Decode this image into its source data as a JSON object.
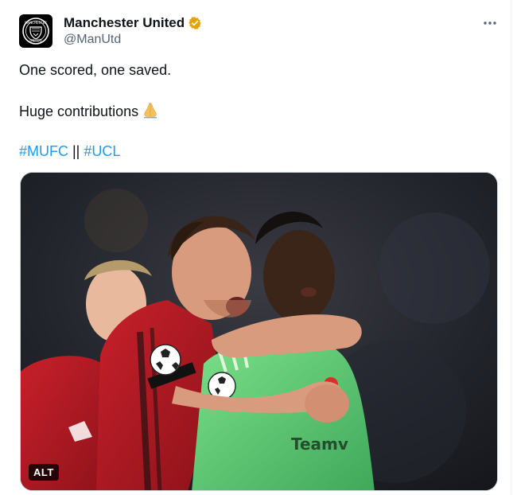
{
  "author": {
    "display_name": "Manchester United",
    "handle": "@ManUtd",
    "verified": true,
    "verified_color": "#e2a400",
    "avatar_icon": "manchester-united-crest-icon"
  },
  "more_icon": "more-options-icon",
  "tweet": {
    "line1": "One scored, one saved.",
    "line2": "Huge contributions",
    "line2_emoji": "folded-hands-icon",
    "hashtag1": "#MUFC",
    "separator": " || ",
    "hashtag2": "#UCL"
  },
  "media": {
    "alt_label": "ALT"
  },
  "colors": {
    "link": "#1d9bf0",
    "text": "#0f1419",
    "secondary": "#536471"
  }
}
